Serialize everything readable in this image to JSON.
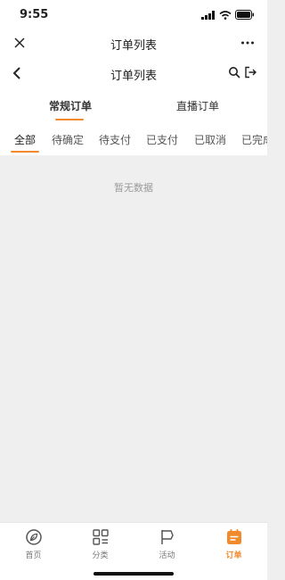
{
  "status_bar": {
    "time": "9:55"
  },
  "mini_program": {
    "title": "订单列表"
  },
  "header": {
    "title": "订单列表"
  },
  "order_types": [
    {
      "label": "常规订单",
      "active": true
    },
    {
      "label": "直播订单",
      "active": false
    }
  ],
  "status_tabs": [
    {
      "label": "全部",
      "active": true
    },
    {
      "label": "待确定",
      "active": false
    },
    {
      "label": "待支付",
      "active": false
    },
    {
      "label": "已支付",
      "active": false
    },
    {
      "label": "已取消",
      "active": false
    },
    {
      "label": "已完成",
      "active": false
    }
  ],
  "empty_text": "暂无数据",
  "tabbar": [
    {
      "label": "首页",
      "icon": "home-icon",
      "active": false
    },
    {
      "label": "分类",
      "icon": "category-icon",
      "active": false
    },
    {
      "label": "活动",
      "icon": "flag-icon",
      "active": false
    },
    {
      "label": "订单",
      "icon": "order-icon",
      "active": true
    }
  ],
  "colors": {
    "accent": "#f08a2c",
    "background": "#efefef"
  }
}
